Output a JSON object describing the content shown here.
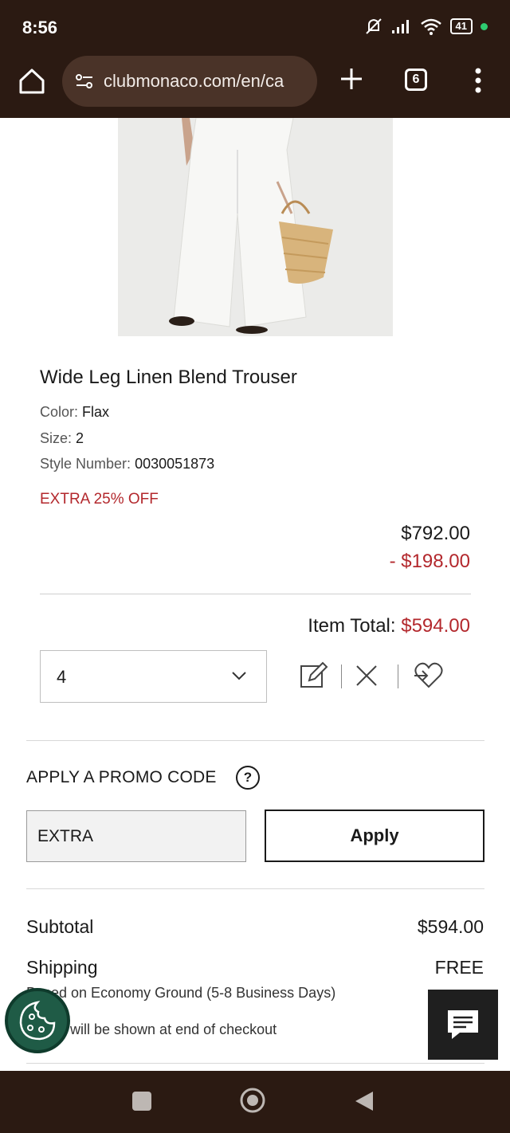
{
  "status_bar": {
    "time": "8:56",
    "battery": "41"
  },
  "browser": {
    "url": "clubmonaco.com/en/ca",
    "tab_count": "6"
  },
  "product": {
    "title": "Wide Leg Linen Blend Trouser",
    "color_label": "Color:",
    "color_value": "Flax",
    "size_label": "Size:",
    "size_value": "2",
    "style_label": "Style Number:",
    "style_value": "0030051873",
    "promo_tag": "EXTRA 25% OFF",
    "original_price": "$792.00",
    "discount": "- $198.00",
    "item_total_label": "Item Total:",
    "item_total_value": "$594.00",
    "quantity": "4"
  },
  "promo": {
    "heading": "APPLY A PROMO CODE",
    "help": "?",
    "code_value": "EXTRA",
    "apply_label": "Apply"
  },
  "summary": {
    "subtotal_label": "Subtotal",
    "subtotal_value": "$594.00",
    "shipping_label": "Shipping",
    "shipping_value": "FREE",
    "shipping_note": "Based on Economy Ground (5-8 Business Days)",
    "tax_note": "will be shown at end of checkout"
  },
  "colors": {
    "accent_red": "#b3282d",
    "chrome_brown": "#2b1a12",
    "cookie_green": "#1f5b46"
  }
}
